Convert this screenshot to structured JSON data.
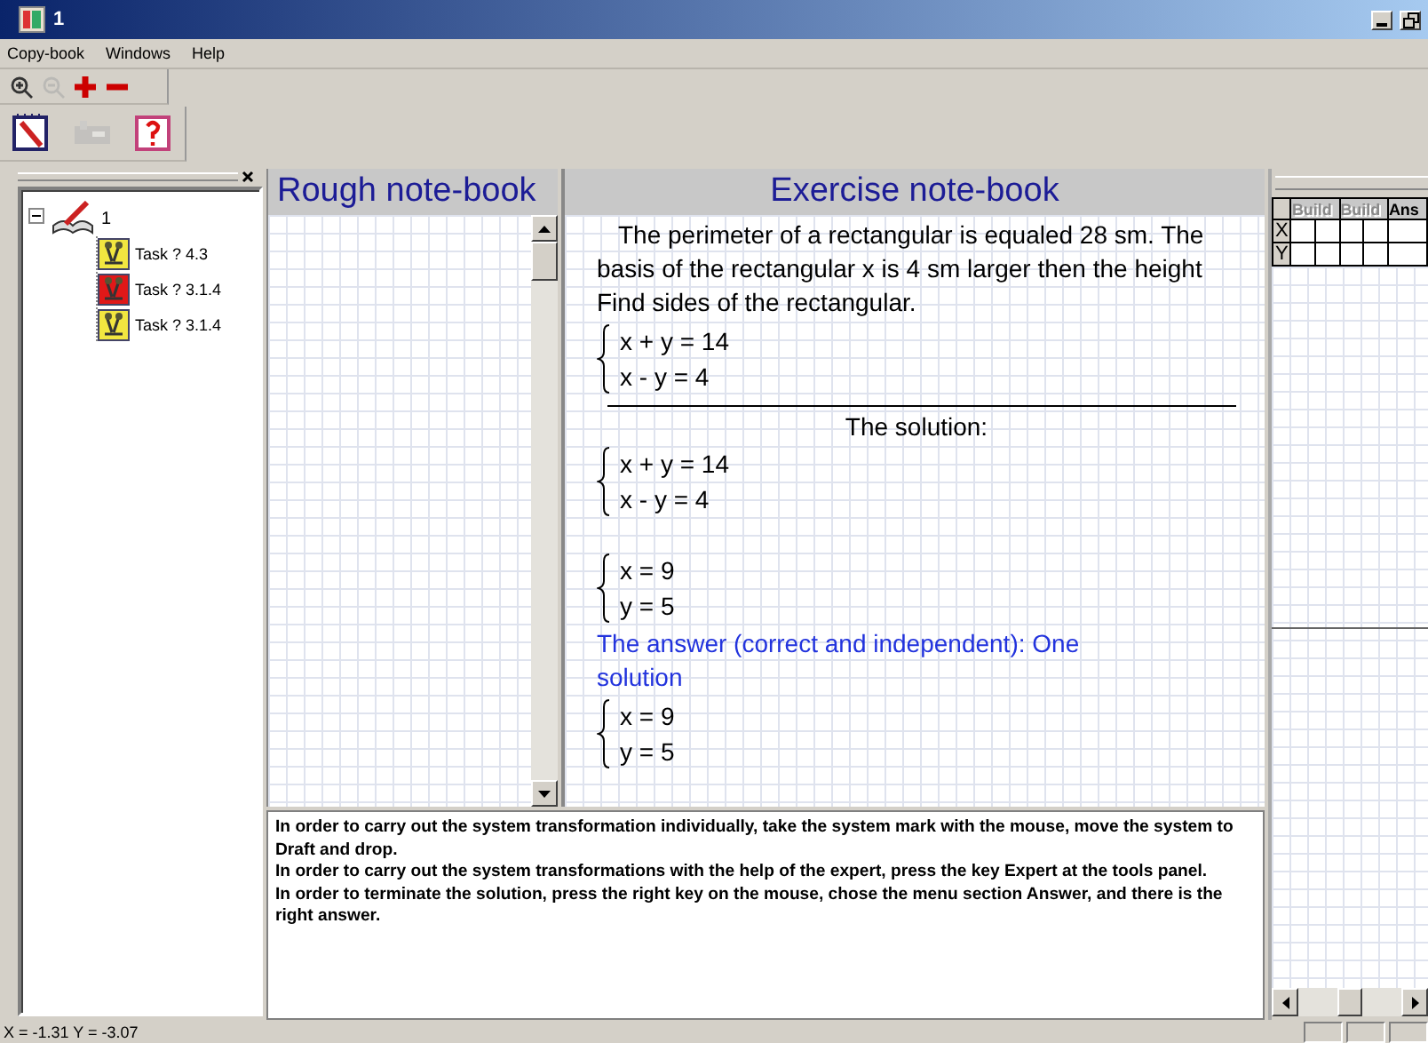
{
  "window": {
    "title": "1"
  },
  "menu": [
    "Copy-book",
    "Windows",
    "Help"
  ],
  "toolbar_1": [
    {
      "kind": "zoom-in",
      "disabled": false
    },
    {
      "kind": "zoom-out",
      "disabled": true
    },
    {
      "kind": "plus",
      "disabled": false
    },
    {
      "kind": "minus",
      "disabled": false
    }
  ],
  "toolbar_2": [
    {
      "kind": "notebook",
      "disabled": false
    },
    {
      "kind": "machine",
      "disabled": true
    },
    {
      "kind": "help",
      "disabled": false
    }
  ],
  "tree": {
    "label": "1",
    "expanded": true,
    "children": [
      {
        "label": "Task ? 4.3",
        "color": "#f2e640"
      },
      {
        "label": "Task ? 3.1.4",
        "color": "#e01818"
      },
      {
        "label": "Task ? 3.1.4",
        "color": "#f2e640"
      }
    ]
  },
  "rough": {
    "title": "Rough note-book"
  },
  "exercise": {
    "title": "Exercise note-book",
    "content": [
      {
        "kind": "text",
        "text": "The perimeter of a rectangular is equaled 28 sm. The basis of the rectangular x is 4 sm larger then the height Find sides of the rectangular."
      },
      {
        "kind": "system",
        "lines": [
          "x + y = 14",
          "x - y = 4"
        ]
      },
      {
        "kind": "rule"
      },
      {
        "kind": "heading",
        "text": "The solution:"
      },
      {
        "kind": "system",
        "lines": [
          "x + y = 14",
          "x - y = 4"
        ]
      },
      {
        "kind": "gap"
      },
      {
        "kind": "system",
        "lines": [
          "x = 9",
          "y = 5"
        ]
      },
      {
        "kind": "answer",
        "text": "The answer (correct and independent): One solution"
      },
      {
        "kind": "system",
        "lines": [
          "x = 9",
          "y = 5"
        ]
      }
    ]
  },
  "hints": [
    "In order to carry out the system transformation individually, take the system mark with the mouse,  move the system to Draft and drop.",
    "In order to carry out the system transformations with the help of the expert, press the key Expert at the tools panel.",
    "In order to terminate the solution, press the right key on the mouse, chose the menu section Answer, and there is the right answer."
  ],
  "table": {
    "columns": [
      {
        "label": "Build",
        "disabled": true
      },
      {
        "label": "Build",
        "disabled": true
      },
      {
        "label": "Ans",
        "disabled": false
      }
    ],
    "rows": [
      "X",
      "Y"
    ]
  },
  "status_bar": "X = -1.31  Y = -3.07"
}
